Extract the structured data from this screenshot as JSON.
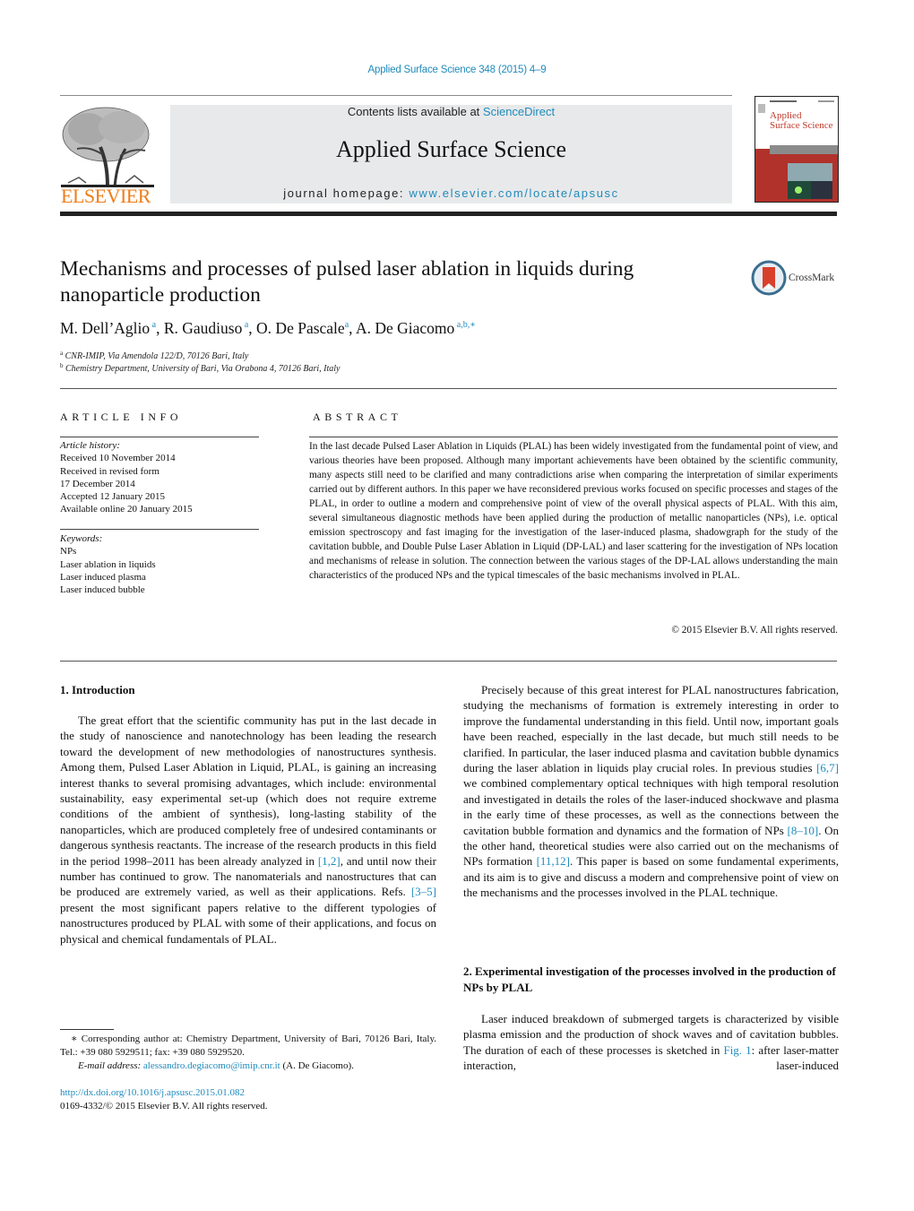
{
  "header": {
    "journal_reference": "Applied Surface Science 348 (2015) 4–9",
    "contents_prefix": "Contents lists available at ",
    "contents_link": "ScienceDirect",
    "journal_title": "Applied Surface Science",
    "homepage_prefix": "journal homepage: ",
    "homepage_link": "www.elsevier.com/locate/apsusc",
    "publisher_wordmark": "ELSEVIER",
    "cover_title_line1": "Applied",
    "cover_title_line2": "Surface Science",
    "logo_icon": "elsevier-tree-icon",
    "cover_icon": "journal-cover-image"
  },
  "article": {
    "title": "Mechanisms and processes of pulsed laser ablation in liquids during nanoparticle production",
    "crossmark_label": "CrossMark",
    "authors": [
      {
        "name": "M. Dell’Aglio",
        "sup": "a"
      },
      {
        "name": "R. Gaudiuso",
        "sup": "a"
      },
      {
        "name": "O. De Pascale",
        "sup": "a"
      },
      {
        "name": "A. De Giacomo",
        "sup": "a,b,∗"
      }
    ],
    "affiliations": [
      {
        "mark": "a",
        "text": "CNR-IMIP, Via Amendola 122/D, 70126 Bari, Italy"
      },
      {
        "mark": "b",
        "text": "Chemistry Department, University of Bari, Via Orabona 4, 70126 Bari, Italy"
      }
    ]
  },
  "article_info": {
    "heading": "ARTICLE INFO",
    "history_label": "Article history:",
    "history": [
      "Received 10 November 2014",
      "Received in revised form",
      "17 December 2014",
      "Accepted 12 January 2015",
      "Available online 20 January 2015"
    ],
    "keywords_label": "Keywords:",
    "keywords": [
      "NPs",
      "Laser ablation in liquids",
      "Laser induced plasma",
      "Laser induced bubble"
    ]
  },
  "abstract": {
    "heading": "ABSTRACT",
    "text": "In the last decade Pulsed Laser Ablation in Liquids (PLAL) has been widely investigated from the fundamental point of view, and various theories have been proposed. Although many important achievements have been obtained by the scientific community, many aspects still need to be clarified and many contradictions arise when comparing the interpretation of similar experiments carried out by different authors. In this paper we have reconsidered previous works focused on specific processes and stages of the PLAL, in order to outline a modern and comprehensive point of view of the overall physical aspects of PLAL. With this aim, several simultaneous diagnostic methods have been applied during the production of metallic nanoparticles (NPs), i.e. optical emission spectroscopy and fast imaging for the investigation of the laser-induced plasma, shadowgraph for the study of the cavitation bubble, and Double Pulse Laser Ablation in Liquid (DP-LAL) and laser scattering for the investigation of NPs location and mechanisms of release in solution. The connection between the various stages of the DP-LAL allows understanding the main characteristics of the produced NPs and the typical timescales of the basic mechanisms involved in PLAL.",
    "copyright": "© 2015 Elsevier B.V. All rights reserved."
  },
  "body": {
    "section1_heading": "1.  Introduction",
    "section1_p1": [
      "The great effort that the scientific community has put in the last decade in the study of nanoscience and nanotechnology has been leading the research toward the development of new methodologies of nanostructures synthesis. Among them, Pulsed Laser Ablation in Liquid, PLAL, is gaining an increasing interest thanks to several promising advantages, which include: environmental sustainability, easy experimental set-up (which does not require extreme conditions of the ambient of synthesis), long-lasting stability of the nanoparticles, which are produced completely free of undesired contaminants or dangerous synthesis reactants. The increase of the research products in this field in the period 1998–2011 has been already analyzed in ",
      "[1,2]",
      ", and until now their number has continued to grow. The nanomaterials and nanostructures that can be produced are extremely varied, as well as their applications. Refs. ",
      "[3–5]",
      " present the most significant papers relative to the different typologies of nanostructures produced by PLAL with some of their applications, and focus on physical and chemical fundamentals of PLAL."
    ],
    "section1_p2": [
      "Precisely because of this great interest for PLAL nanostructures fabrication, studying the mechanisms of formation is extremely interesting in order to improve the fundamental understanding in this field. Until now, important goals have been reached, especially in the last decade, but much still needs to be clarified. In particular, the laser induced plasma and cavitation bubble dynamics during the laser ablation in liquids play crucial roles. In previous studies ",
      "[6,7]",
      " we combined complementary optical techniques with high temporal resolution and investigated in details the roles of the laser-induced shockwave and plasma in the early time of these processes, as well as the connections between the cavitation bubble formation and dynamics and the formation of NPs ",
      "[8–10]",
      ". On the other hand, theoretical studies were also carried out on the mechanisms of NPs formation ",
      "[11,12]",
      ". This paper is based on some fundamental experiments, and its aim is to give and discuss a modern and comprehensive point of view on the mechanisms and the processes involved in the PLAL technique."
    ],
    "section2_heading": "2.  Experimental investigation of the processes involved in the production of NPs by PLAL",
    "section2_p1": [
      "Laser induced breakdown of submerged targets is characterized by visible plasma emission and the production of shock waves and of cavitation bubbles. The duration of each of these processes is sketched in ",
      "Fig. 1",
      ": after laser-matter interaction, laser-induced"
    ]
  },
  "footnotes": {
    "corresponding": "∗ Corresponding author at: Chemistry Department, University of Bari, 70126 Bari, Italy. Tel.: +39 080 5929511; fax: +39 080 5929520.",
    "email_label": "E-mail address: ",
    "email": "alessandro.degiacomo@imip.cnr.it",
    "email_suffix": " (A. De Giacomo).",
    "doi": "http://dx.doi.org/10.1016/j.apsusc.2015.01.082",
    "issn_copyright": "0169-4332/© 2015 Elsevier B.V. All rights reserved."
  },
  "colors": {
    "link": "#1f8bbd",
    "elsevier_orange": "#f07d18",
    "masthead_bg": "#e8e9ea",
    "cover_red": "#b0322b"
  }
}
